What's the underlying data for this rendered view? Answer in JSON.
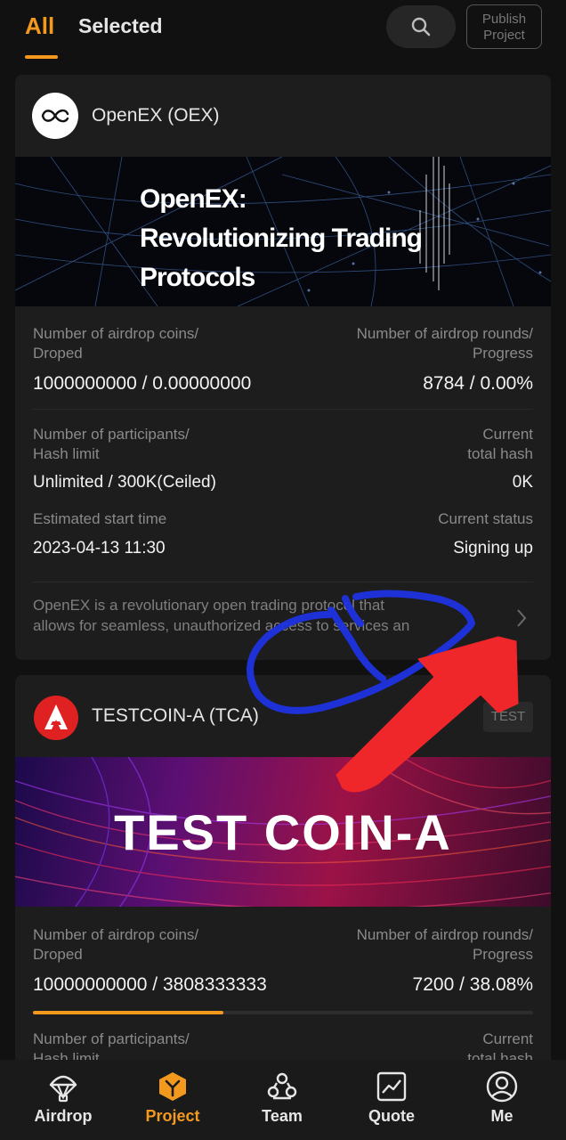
{
  "header": {
    "tab_all": "All",
    "tab_selected": "Selected",
    "publish_line1": "Publish",
    "publish_line2": "Project",
    "search_icon": "search-icon"
  },
  "colors": {
    "accent": "#f39a1e",
    "background": "#111111",
    "card": "#1d1d1d"
  },
  "projects": [
    {
      "name": "OpenEX (OEX)",
      "logo_icon": "openex-logo",
      "banner_lines": [
        "OpenEX:",
        "Revolutionizing Trading",
        "Protocols"
      ],
      "airdrop_coins_label_1": "Number of airdrop coins/",
      "airdrop_coins_label_2": "Droped",
      "airdrop_coins_value": "1000000000 / 0.00000000",
      "airdrop_rounds_label_1": "Number of airdrop rounds/",
      "airdrop_rounds_label_2": "Progress",
      "airdrop_rounds_value": "8784 / 0.00%",
      "participants_label_1": "Number of participants/",
      "participants_label_2": "Hash limit",
      "participants_value": "Unlimited / 300K(Ceiled)",
      "hash_label_1": "Current",
      "hash_label_2": "total hash",
      "hash_value": "0K",
      "start_label": "Estimated start time",
      "start_value": "2023-04-13 11:30",
      "status_label": "Current status",
      "status_value": "Signing up",
      "description_1": "OpenEX is a revolutionary open trading protocol that",
      "description_2": "allows for seamless, unauthorized access to services an"
    },
    {
      "name": "TESTCOIN-A (TCA)",
      "logo_icon": "testcoin-logo",
      "tag": "TEST",
      "banner_text": "TEST COIN-A",
      "airdrop_coins_label_1": "Number of airdrop coins/",
      "airdrop_coins_label_2": "Droped",
      "airdrop_coins_value": "10000000000 / 3808333333",
      "airdrop_rounds_label_1": "Number of airdrop rounds/",
      "airdrop_rounds_label_2": "Progress",
      "airdrop_rounds_value": "7200 / 38.08%",
      "progress_fraction": 0.3808,
      "participants_label_1": "Number of participants/",
      "participants_label_2": "Hash limit",
      "hash_label_1": "Current",
      "hash_label_2": "total hash"
    }
  ],
  "bottom_nav": [
    {
      "label": "Airdrop",
      "icon": "parachute-icon",
      "active": false
    },
    {
      "label": "Project",
      "icon": "cube-icon",
      "active": true
    },
    {
      "label": "Team",
      "icon": "team-icon",
      "active": false
    },
    {
      "label": "Quote",
      "icon": "chart-icon",
      "active": false
    },
    {
      "label": "Me",
      "icon": "user-icon",
      "active": false
    }
  ]
}
